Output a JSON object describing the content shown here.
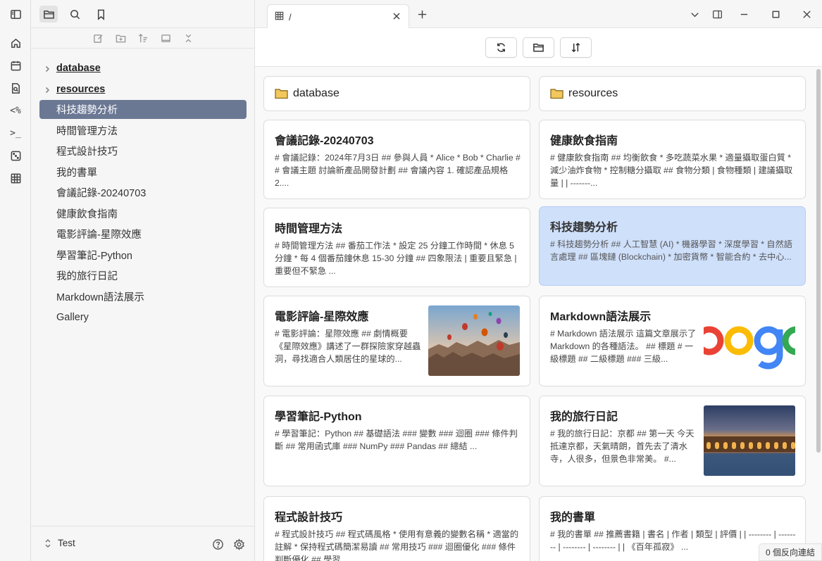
{
  "ribbon": {
    "icons": [
      "home-icon",
      "calendar-icon",
      "search-file-icon",
      "code-percent-icon",
      "terminal-icon",
      "dice-icon",
      "table-icon"
    ],
    "percent_label": "<%",
    "terminal_label": ">_"
  },
  "sidebar": {
    "tabs": [
      "files-icon",
      "search-icon",
      "bookmark-icon"
    ],
    "actions": [
      "new-note-icon",
      "new-folder-icon",
      "sort-icon",
      "auto-reveal-icon",
      "collapse-all-icon"
    ],
    "folders": [
      {
        "label": "database"
      },
      {
        "label": "resources"
      }
    ],
    "files": [
      {
        "label": "科技趨勢分析",
        "active": true
      },
      {
        "label": "時間管理方法"
      },
      {
        "label": "程式設計技巧"
      },
      {
        "label": "我的書單"
      },
      {
        "label": "會議記錄-20240703"
      },
      {
        "label": "健康飲食指南"
      },
      {
        "label": "電影評論-星際效應"
      },
      {
        "label": "學習筆記-Python"
      },
      {
        "label": "我的旅行日記"
      },
      {
        "label": "Markdown語法展示"
      },
      {
        "label": "Gallery"
      }
    ],
    "vault_name": "Test"
  },
  "tab": {
    "title": "/"
  },
  "toolbar": {
    "buttons": [
      "refresh-icon",
      "folder-icon",
      "sort-icon"
    ]
  },
  "cards": {
    "folders": [
      {
        "label": "database"
      },
      {
        "label": "resources"
      }
    ],
    "notes": [
      {
        "title": "會議記錄-20240703",
        "excerpt": "# 會議記錄：2024年7月3日 ## 參與人員 * Alice * Bob * Charlie ## 會議主題 討論新產品開發計劃 ## 會議內容 1. 確認產品規格 2...."
      },
      {
        "title": "健康飲食指南",
        "excerpt": "# 健康飲食指南 ## 均衡飲食 * 多吃蔬菜水果 * 適量攝取蛋白質 * 減少油炸食物 * 控制糖分攝取 ## 食物分類 | 食物種類 | 建議攝取量 | | -------..."
      },
      {
        "title": "時間管理方法",
        "excerpt": "# 時間管理方法 ## 番茄工作法 * 設定 25 分鐘工作時間 * 休息 5 分鐘 * 每 4 個番茄鐘休息 15-30 分鐘 ## 四象限法 | 重要且緊急 | 重要但不緊急 ..."
      },
      {
        "title": "科技趨勢分析",
        "excerpt": "# 科技趨勢分析 ## 人工智慧 (AI) * 機器學習 * 深度學習 * 自然語言處理 ## 區塊鏈 (Blockchain) * 加密貨幣 * 智能合約 * 去中心...",
        "selected": true
      },
      {
        "title": "電影評論-星際效應",
        "excerpt": "# 電影評論：星際效應 ## 劇情概要 《星際效應》講述了一群探險家穿越蟲洞，尋找適合人類居住的星球的..."
      },
      {
        "title": "Markdown語法展示",
        "excerpt": "# Markdown 語法展示 這篇文章展示了 Markdown 的各種語法。 ## 標題 # 一級標題 ## 二級標題 ### 三級..."
      },
      {
        "title": "學習筆記-Python",
        "excerpt": "# 學習筆記：Python ## 基礎語法 ### 變數 ### 迴圈 ### 條件判斷 ## 常用函式庫 ### NumPy ### Pandas ## 總結 ..."
      },
      {
        "title": "我的旅行日記",
        "excerpt": "# 我的旅行日記：京都 ## 第一天 今天抵達京都，天氣晴朗，首先去了清水寺，人很多，但景色非常美。 #..."
      },
      {
        "title": "程式設計技巧",
        "excerpt": "# 程式設計技巧 ## 程式碼風格 * 使用有意義的變數名稱 * 適當的註解 * 保持程式碼簡潔易讀 ## 常用技巧 ### 迴圈優化 ### 條件判斷優化 ## 學習"
      },
      {
        "title": "我的書單",
        "excerpt": "# 我的書單 ## 推薦書籍 | 書名 | 作者 | 類型 | 評價 | | -------- | -------- | -------- | -------- | | 《百年孤寂》 ..."
      }
    ]
  },
  "status": {
    "backlinks": "0 個反向連結"
  },
  "colors": {
    "active_item": "#6b7894",
    "selected_card": "#cfe0fb",
    "folder_icon": "#e8b84a"
  }
}
